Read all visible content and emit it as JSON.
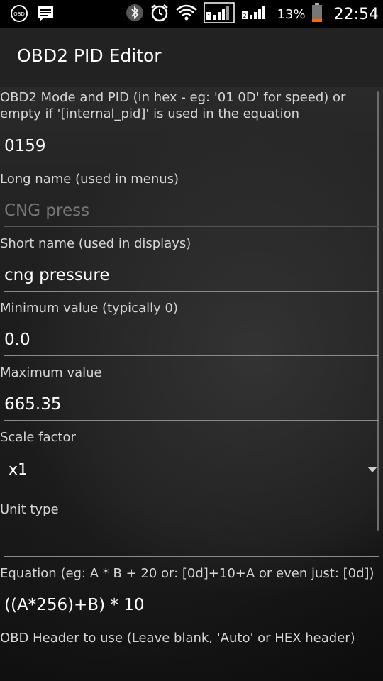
{
  "status_bar": {
    "battery_percent": "13%",
    "time": "22:54",
    "obd_icon_text": "OBD"
  },
  "action_bar": {
    "title": "OBD2 PID Editor"
  },
  "form": {
    "pid_label": "OBD2 Mode and PID (in hex - eg: '01 0D' for speed) or empty if '[internal_pid]' is used in the equation",
    "pid_value": "0159",
    "long_name_label": "Long name (used in menus)",
    "long_name_placeholder": "CNG press",
    "short_name_label": "Short name (used in displays)",
    "short_name_value": "cng pressure",
    "min_label": "Minimum value (typically 0)",
    "min_value": "0.0",
    "max_label": "Maximum value",
    "max_value": "665.35",
    "scale_label": "Scale factor",
    "scale_value": "x1",
    "unit_label": "Unit type",
    "unit_value": "",
    "equation_label": "Equation (eg:  A * B + 20   or: [0d]+10+A  or even just: [0d])",
    "equation_value": "((A*256)+B) * 10",
    "header_label": "OBD Header to use (Leave blank, 'Auto' or HEX header)"
  }
}
